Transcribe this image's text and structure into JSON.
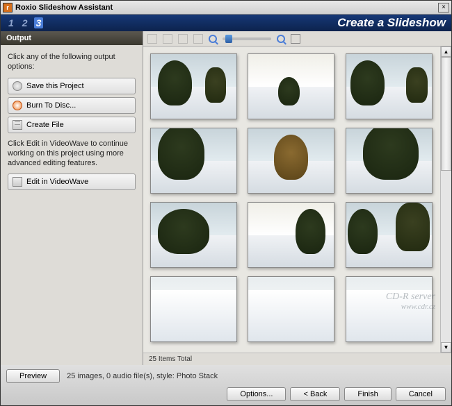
{
  "window": {
    "title": "Roxio Slideshow Assistant",
    "close_symbol": "×"
  },
  "header": {
    "step1": "1",
    "step2": "2",
    "step3": "3",
    "title": "Create a Slideshow"
  },
  "sidebar": {
    "section": "Output",
    "intro": "Click any of the following output options:",
    "save_label": "Save this Project",
    "burn_label": "Burn To Disc...",
    "create_file_label": "Create File",
    "videowave_intro": "Click Edit in VideoWave to continue working on this project using more advanced editing features.",
    "edit_videowave_label": "Edit in VideoWave"
  },
  "toolbar": {
    "icons": [
      "monitor-icon",
      "close-icon",
      "rotate-left-icon",
      "rotate-right-icon",
      "zoom-out-icon",
      "slider",
      "zoom-in-icon",
      "grid-icon"
    ]
  },
  "thumbnails": {
    "visible_count": 12
  },
  "status": {
    "total": "25 Items Total"
  },
  "footer": {
    "preview_label": "Preview",
    "summary": "25 images,  0 audio file(s), style: Photo Stack",
    "options_label": "Options...",
    "back_label": "< Back",
    "finish_label": "Finish",
    "cancel_label": "Cancel"
  },
  "watermark": {
    "line1": "CD-R server",
    "line2": "www.cdr.cz"
  }
}
